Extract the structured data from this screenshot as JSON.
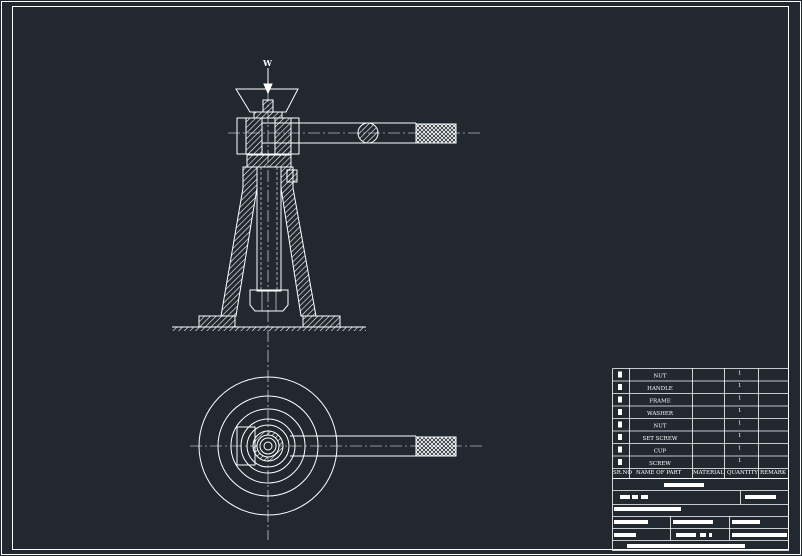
{
  "drawing": {
    "load_label": "W",
    "background": "#212830",
    "line_color": "#ffffff"
  },
  "bom": {
    "headers": {
      "sr_no": "SR.NO",
      "name": "NAME OF PART",
      "material": "MATERIAL",
      "quantity": "QUANTITY",
      "remark": "REMARK"
    },
    "rows": [
      {
        "name": "NUT",
        "quantity": "1"
      },
      {
        "name": "HANDLE",
        "quantity": "1"
      },
      {
        "name": "FRAME",
        "quantity": "1"
      },
      {
        "name": "WASHER",
        "quantity": "1"
      },
      {
        "name": "NUT",
        "quantity": "1"
      },
      {
        "name": "SET SCREW",
        "quantity": "1"
      },
      {
        "name": "CUP",
        "quantity": "1"
      },
      {
        "name": "SCREW",
        "quantity": "1"
      }
    ]
  }
}
